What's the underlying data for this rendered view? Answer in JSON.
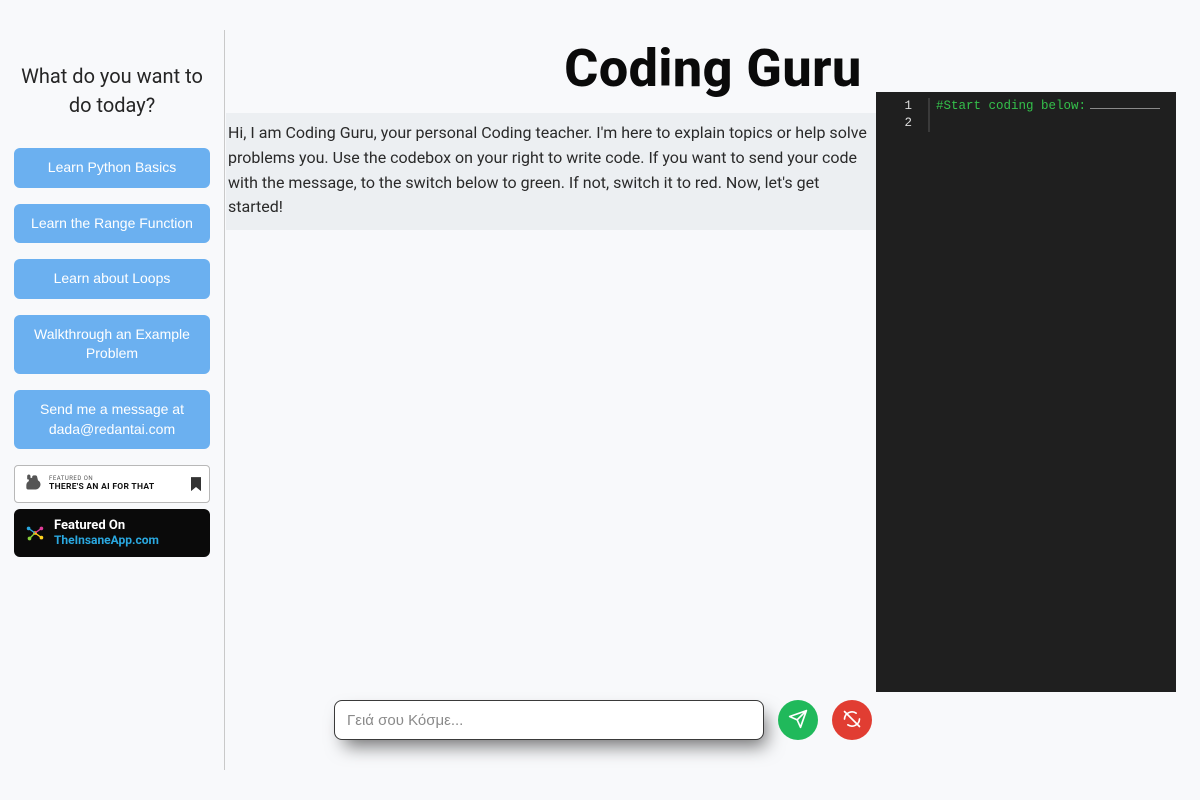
{
  "sidebar": {
    "title": "What do you want to do today?",
    "buttons": [
      "Learn Python Basics",
      "Learn the Range Function",
      "Learn about Loops",
      "Walkthrough an Example Problem",
      "Send me a message at dada@redantai.com"
    ],
    "badge1": {
      "line1": "FEATURED ON",
      "line2": "THERE'S AN AI FOR THAT"
    },
    "badge2": {
      "line1": "Featured On",
      "line2": "TheInsaneApp.com"
    }
  },
  "main": {
    "title": "Coding Guru",
    "intro": "Hi, I am Coding Guru, your personal Coding teacher. I'm here to explain topics or help solve problems you. Use the codebox on your right to write code. If you want to send your code with the message, to the switch below to green. If not, switch it to red. Now, let's get started!"
  },
  "compose": {
    "placeholder": "Γειά σου Κόσμε..."
  },
  "editor": {
    "lines": [
      "1",
      "2"
    ],
    "content": "#Start coding below:"
  }
}
